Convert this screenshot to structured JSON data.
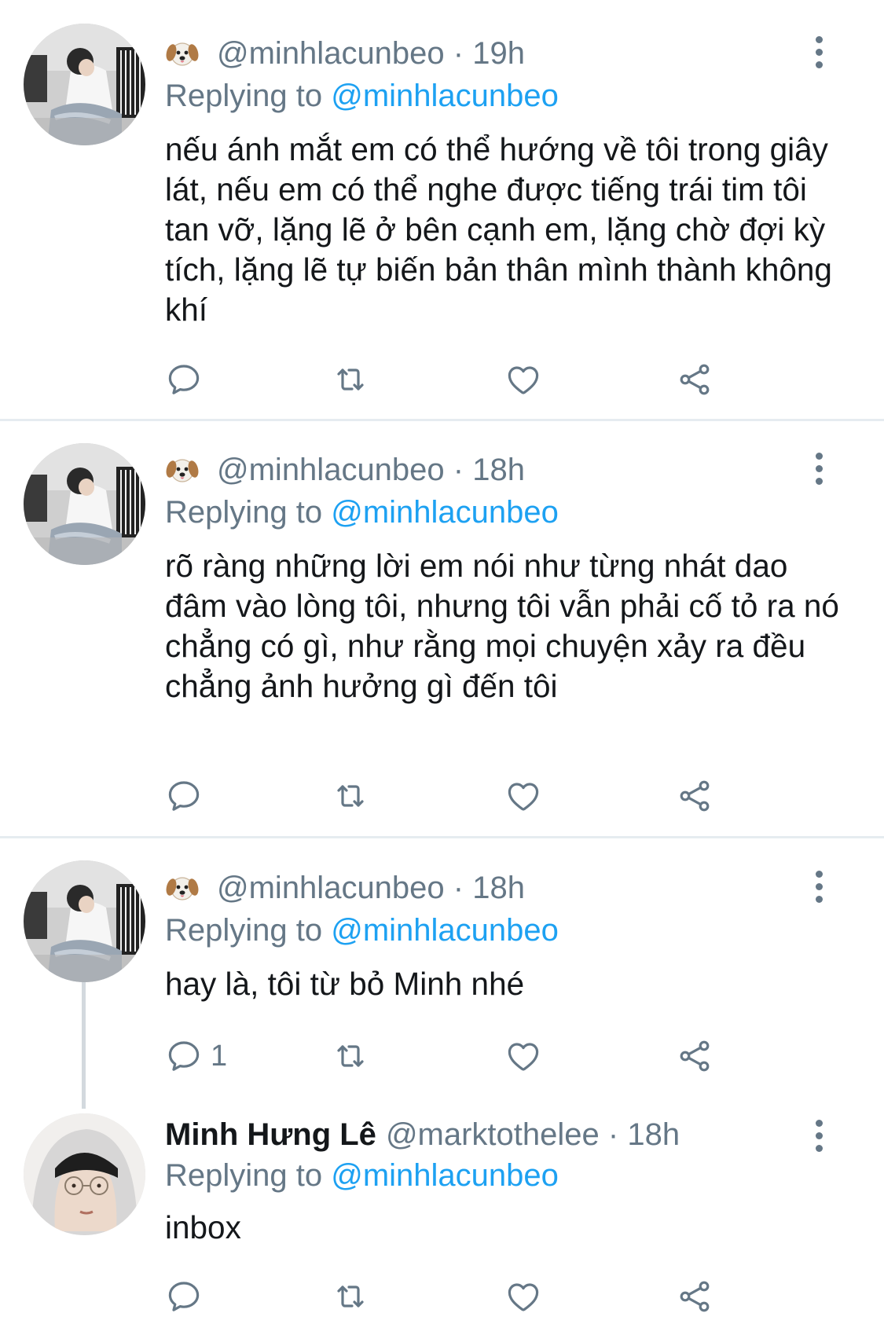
{
  "tweets": [
    {
      "handle": "@minhlacunbeo",
      "time": "· 19h",
      "replying_prefix": "Replying to ",
      "replying_to": "@minhlacunbeo",
      "text": "nếu ánh mắt em có thể hướng về tôi trong giây lát, nếu em có thể nghe được tiếng trái tim tôi tan vỡ, lặng lẽ ở bên cạnh em, lặng chờ đợi kỳ tích, lặng lẽ tự biến bản thân mình thành không khí"
    },
    {
      "handle": "@minhlacunbeo",
      "time": "· 18h",
      "replying_prefix": "Replying to ",
      "replying_to": "@minhlacunbeo",
      "text": "rõ ràng những lời em nói như từng nhát dao đâm vào lòng tôi, nhưng tôi vẫn phải cố tỏ ra nó chẳng có gì, như rằng mọi chuyện xảy ra đều chẳng ảnh hưởng gì đến tôi"
    },
    {
      "handle": "@minhlacunbeo",
      "time": "· 18h",
      "replying_prefix": "Replying to ",
      "replying_to": "@minhlacunbeo",
      "text": "hay là, tôi từ bỏ Minh nhé",
      "reply_count": "1"
    },
    {
      "display_name": "Minh Hưng Lê",
      "handle": "@marktothelee",
      "time": "· 18h",
      "replying_prefix": "Replying to ",
      "replying_to": "@minhlacunbeo",
      "text": "inbox"
    }
  ],
  "icons": {
    "reply": "speech-bubble-icon",
    "retweet": "retweet-arrows-icon",
    "like": "heart-icon",
    "share": "share-icon",
    "more": "vertical-dots-icon",
    "emoji": "dog-face-emoji"
  },
  "colors": {
    "link": "#1da1f2",
    "muted": "#657786",
    "text": "#14171a",
    "divider": "#e6ecf0"
  }
}
